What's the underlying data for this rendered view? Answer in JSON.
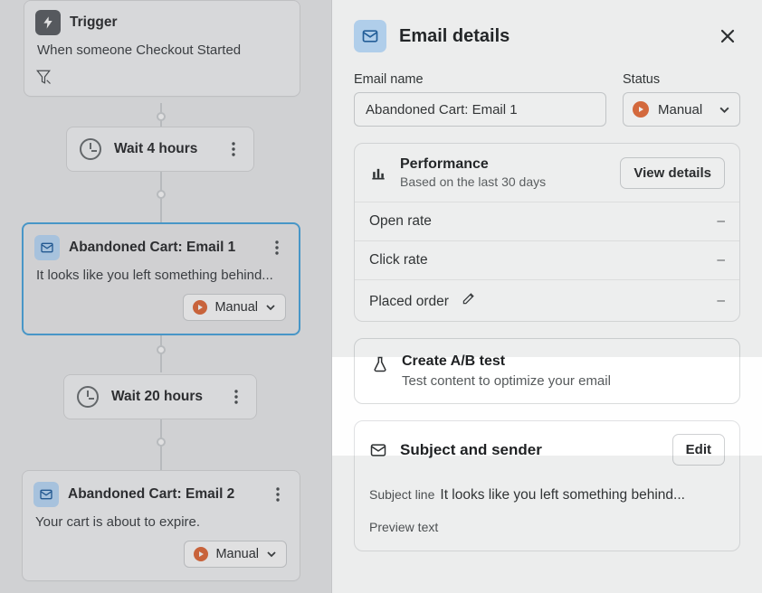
{
  "flow": {
    "trigger": {
      "title": "Trigger",
      "body": "When someone Checkout Started"
    },
    "wait1": {
      "label": "Wait 4 hours"
    },
    "email1": {
      "title": "Abandoned Cart: Email 1",
      "preview": "It looks like you left something behind...",
      "status_label": "Manual"
    },
    "wait2": {
      "label": "Wait 20 hours"
    },
    "email2": {
      "title": "Abandoned Cart: Email 2",
      "preview": "Your cart is about to expire.",
      "status_label": "Manual"
    }
  },
  "panel": {
    "title": "Email details",
    "email_name_label": "Email name",
    "email_name_value": "Abandoned Cart: Email 1",
    "status_label": "Status",
    "status_value": "Manual",
    "performance": {
      "title": "Performance",
      "subtitle": "Based on the last 30 days",
      "view_button": "View details",
      "metrics": [
        {
          "label": "Open rate",
          "value": "–"
        },
        {
          "label": "Click rate",
          "value": "–"
        },
        {
          "label": "Placed order",
          "value": "–"
        }
      ]
    },
    "ab": {
      "title": "Create A/B test",
      "subtitle": "Test content to optimize your email"
    },
    "subject": {
      "heading": "Subject and sender",
      "edit_button": "Edit",
      "subject_line_label": "Subject line",
      "subject_line_value": "It looks like you left something behind...",
      "preview_text_label": "Preview text"
    }
  }
}
